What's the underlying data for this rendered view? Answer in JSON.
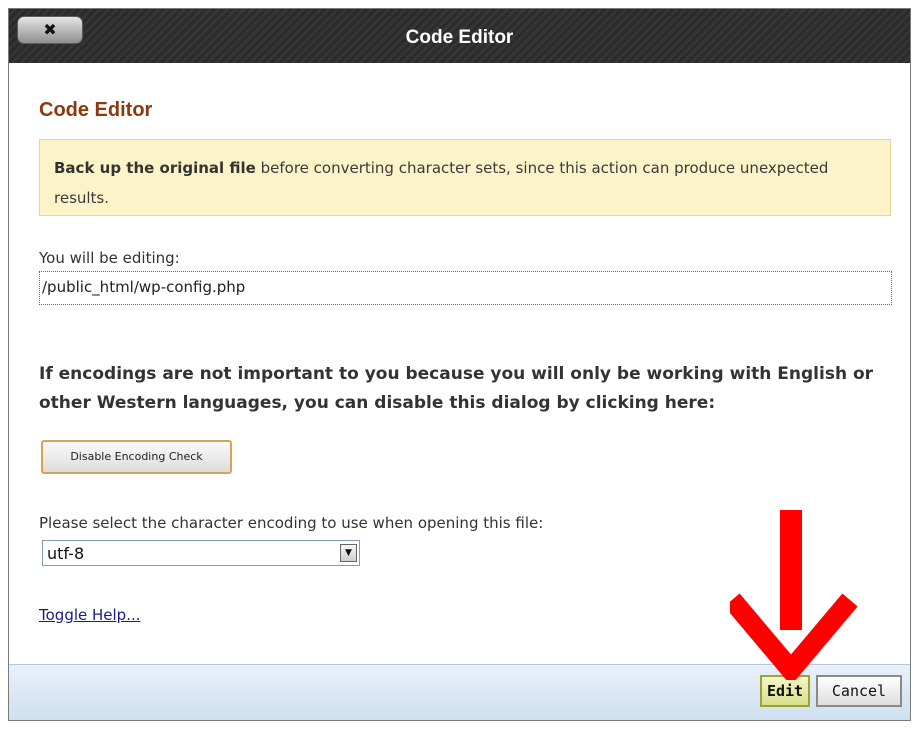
{
  "window": {
    "title": "Code Editor",
    "close_label": "✖"
  },
  "main": {
    "heading": "Code Editor",
    "warning_bold": "Back up the original file",
    "warning_text": " before converting character sets, since this action can produce unexpected results.",
    "editing_label": "You will be editing:",
    "file_path": "/public_html/wp-config.php",
    "encoding_info": "If encodings are not important to you because you will only be working with English or other Western languages, you can disable this dialog by clicking here:",
    "disable_button": "Disable Encoding Check",
    "select_label": "Please select the character encoding to use when opening this file:",
    "encoding_value": "utf-8",
    "help_link": "Toggle Help..."
  },
  "footer": {
    "edit_label": "Edit",
    "cancel_label": "Cancel"
  },
  "colors": {
    "arrow": "#ff0000",
    "heading": "#8b3a10",
    "warning_bg": "#fcf4c8"
  },
  "icons": {
    "close": "close-icon",
    "dropdown": "chevron-down-icon",
    "annotation": "arrow-down-icon"
  }
}
